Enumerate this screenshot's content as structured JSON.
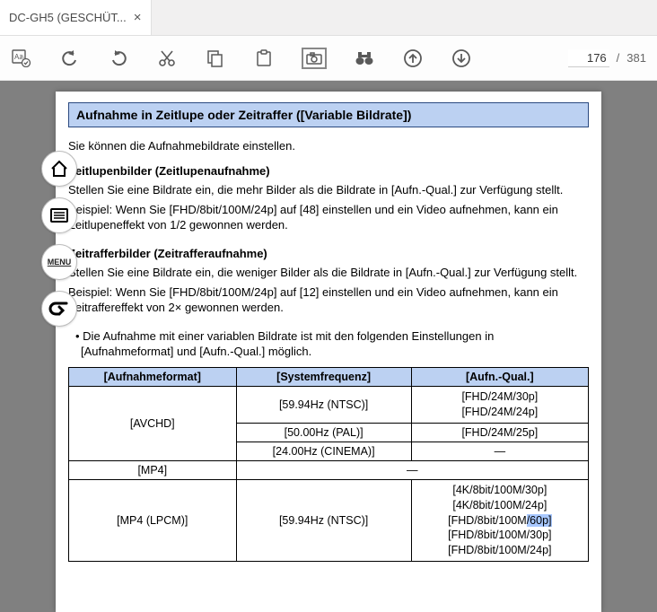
{
  "tab": {
    "title": "DC-GH5 (GESCHÜT...",
    "close": "×"
  },
  "toolbar": {
    "page_current": "176",
    "page_sep": "/",
    "page_total": "381"
  },
  "sidebar": {
    "menu_label": "MENU"
  },
  "doc": {
    "heading": "Aufnahme in Zeitlupe oder Zeitraffer ([Variable Bildrate])",
    "intro": "Sie können die Aufnahmebildrate einstellen.",
    "slow_title": "Zeitlupenbilder (Zeitlupenaufnahme)",
    "slow_p1": "Stellen Sie eine Bildrate ein, die mehr Bilder als die Bildrate in [Aufn.-Qual.] zur Verfügung stellt.",
    "slow_p2": "Beispiel: Wenn Sie [FHD/8bit/100M/24p] auf [48] einstellen und ein Video aufnehmen, kann ein Zeitlupeneffekt von 1/2 gewonnen werden.",
    "fast_title": "Zeitrafferbilder (Zeitrafferaufnahme)",
    "fast_p1": "Stellen Sie eine Bildrate ein, die weniger Bilder als die Bildrate in [Aufn.-Qual.] zur Verfügung stellt.",
    "fast_p2": "Beispiel: Wenn Sie [FHD/8bit/100M/24p] auf [12] einstellen und ein Video aufnehmen, kann ein Zeitraffereffekt von 2× gewonnen werden.",
    "bullet": "• Die Aufnahme mit einer variablen Bildrate ist mit den folgenden Einstellungen in [Aufnahmeformat] und [Aufn.-Qual.] möglich.",
    "table": {
      "h1": "[Aufnahmeformat]",
      "h2": "[Systemfrequenz]",
      "h3": "[Aufn.-Qual.]",
      "r1c1": "[AVCHD]",
      "r1c2": "[59.94Hz (NTSC)]",
      "r1c3a": "[FHD/24M/30p]",
      "r1c3b": "[FHD/24M/24p]",
      "r2c2": "[50.00Hz (PAL)]",
      "r2c3": "[FHD/24M/25p]",
      "r3c2": "[24.00Hz (CINEMA)]",
      "r3c3": "—",
      "r4c1": "[MP4]",
      "r4c3": "—",
      "r5c1": "[MP4 (LPCM)]",
      "r5c2": "[59.94Hz (NTSC)]",
      "r5c3a": "[4K/8bit/100M/30p]",
      "r5c3b": "[4K/8bit/100M/24p]",
      "r5c3c_pre": "[FHD/8bit/100M",
      "r5c3c_sel": "/60p]",
      "r5c3d": "[FHD/8bit/100M/30p]",
      "r5c3e": "[FHD/8bit/100M/24p]"
    }
  }
}
